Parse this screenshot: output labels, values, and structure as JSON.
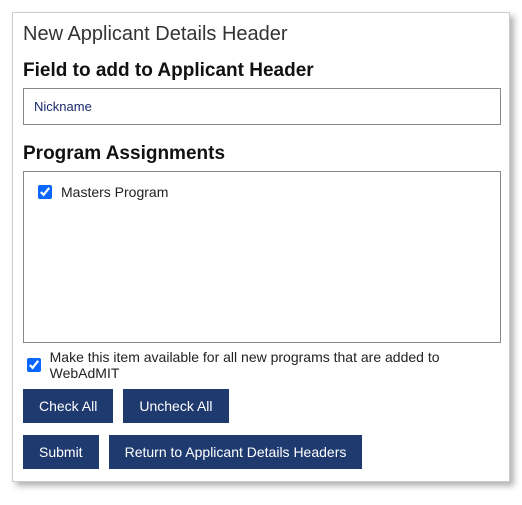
{
  "page": {
    "title": "New Applicant Details Header"
  },
  "field_section": {
    "heading": "Field to add to Applicant Header",
    "selected_value": "Nickname"
  },
  "programs_section": {
    "heading": "Program Assignments",
    "items": [
      {
        "label": "Masters Program",
        "checked": true
      }
    ]
  },
  "availability": {
    "label": "Make this item available for all new programs that are added to WebAdMIT",
    "checked": true
  },
  "buttons": {
    "check_all": "Check All",
    "uncheck_all": "Uncheck All",
    "submit": "Submit",
    "return": "Return to Applicant Details Headers"
  }
}
